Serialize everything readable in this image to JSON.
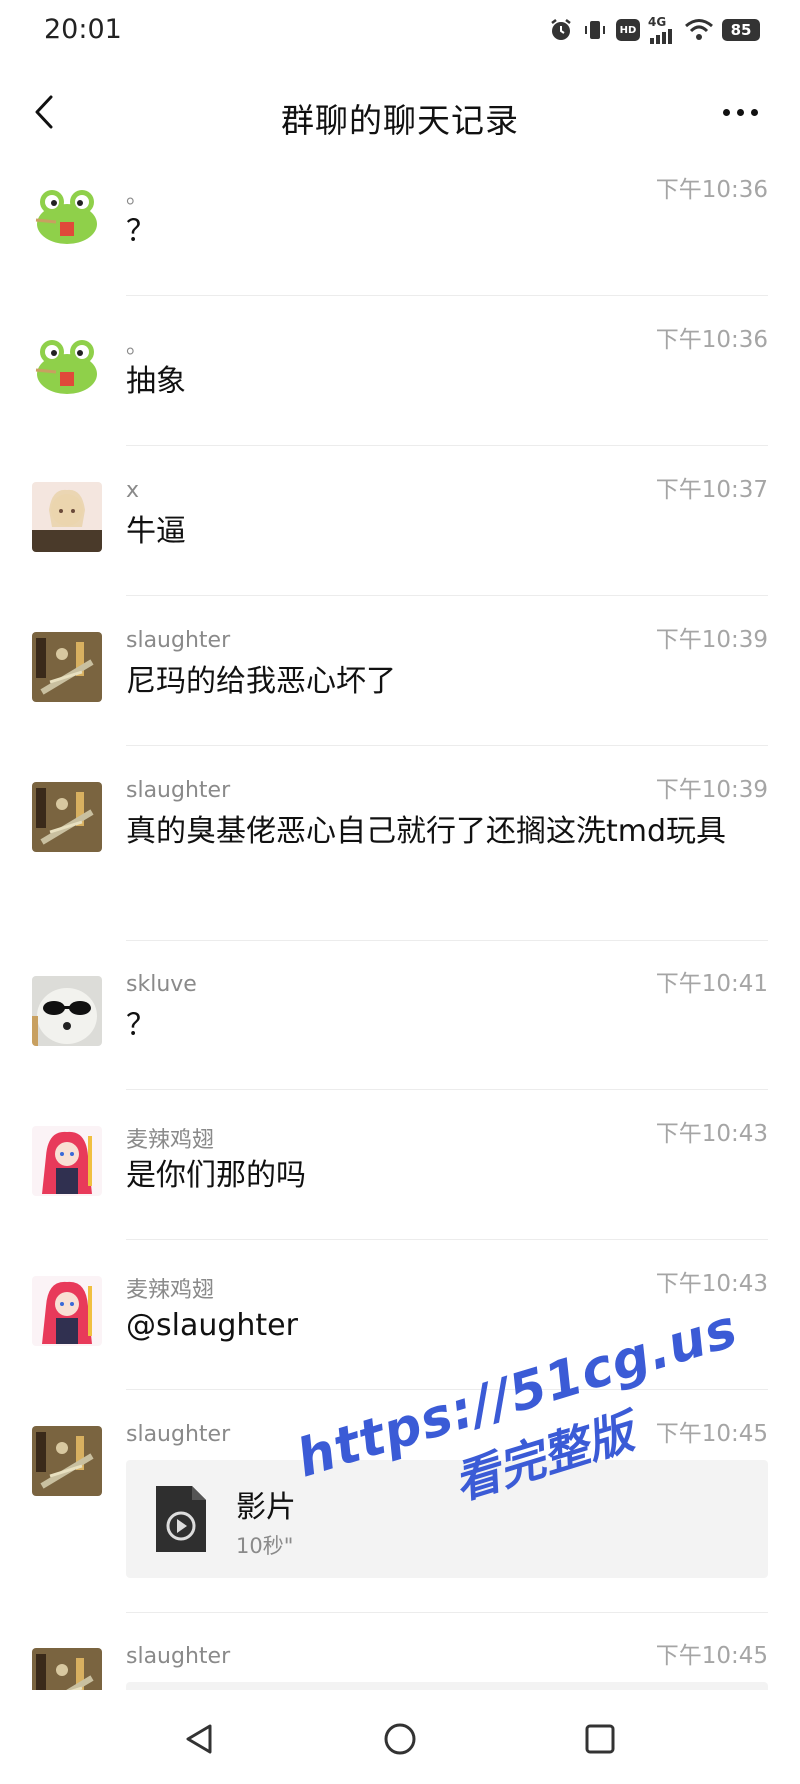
{
  "status_bar": {
    "time": "20:01",
    "network": "4G",
    "hd": "HD",
    "battery": "85"
  },
  "header": {
    "title": "群聊的聊天记录"
  },
  "messages": [
    {
      "sender": "。",
      "time": "下午10:36",
      "text": "？",
      "avatar": "green-frog-sticker"
    },
    {
      "sender": "。",
      "time": "下午10:36",
      "text": "抽象",
      "avatar": "green-frog-sticker"
    },
    {
      "sender": "x",
      "time": "下午10:37",
      "text": "牛逼",
      "avatar": "anime-girl-blonde"
    },
    {
      "sender": "slaughter",
      "time": "下午10:39",
      "text": "尼玛的给我恶心坏了",
      "avatar": "desk-figure-photo"
    },
    {
      "sender": "slaughter",
      "time": "下午10:39",
      "text": "真的臭基佬恶心自己就行了还搁这洗tmd玩具",
      "avatar": "desk-figure-photo"
    },
    {
      "sender": "skluve",
      "time": "下午10:41",
      "text": "？",
      "avatar": "dog-sunglasses"
    },
    {
      "sender": "麦辣鸡翅",
      "time": "下午10:43",
      "text": "是你们那的吗",
      "avatar": "anime-girl-red-hair"
    },
    {
      "sender": "麦辣鸡翅",
      "time": "下午10:43",
      "text": "@slaughter",
      "avatar": "anime-girl-red-hair"
    },
    {
      "sender": "slaughter",
      "time": "下午10:45",
      "video_title": "影片",
      "video_duration": "10秒\"",
      "avatar": "desk-figure-photo"
    },
    {
      "sender": "slaughter",
      "time": "下午10:45",
      "avatar": "desk-figure-photo"
    }
  ],
  "watermark": {
    "line1": "https://51cg.us",
    "line2": "看完整版"
  },
  "colors": {
    "watermark": "#3b5bd6",
    "divider": "#ececec",
    "muted_text": "#8a8a8a"
  }
}
